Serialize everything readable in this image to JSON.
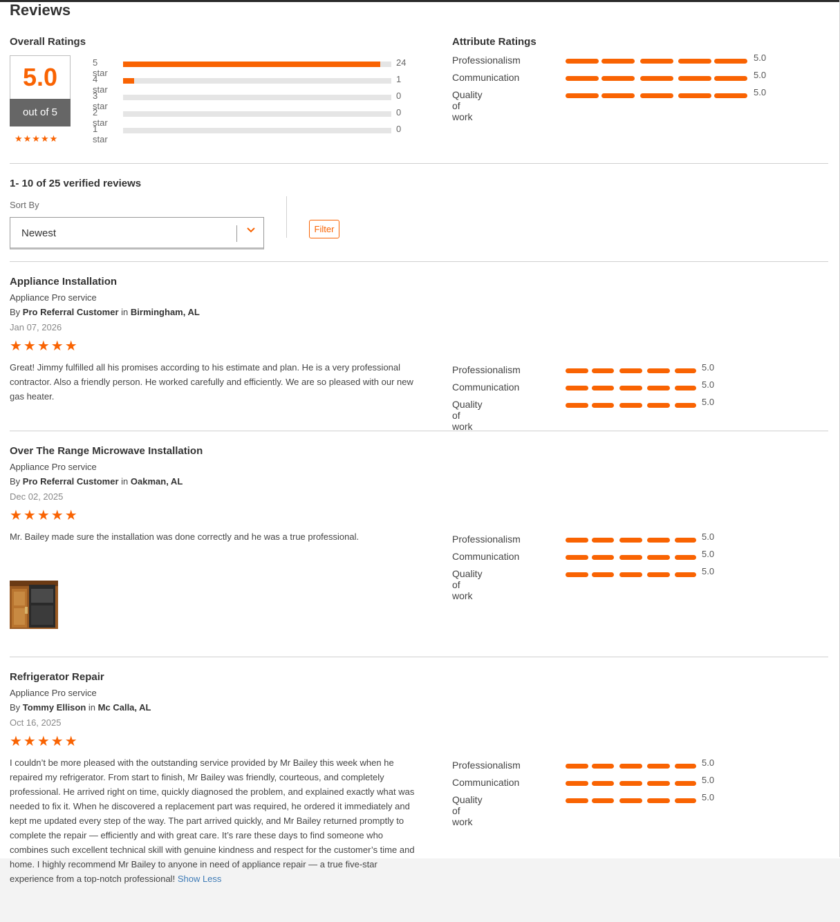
{
  "page": {
    "title": "Reviews"
  },
  "overall": {
    "heading": "Overall Ratings",
    "score": "5.0",
    "out_of": "out of 5",
    "stars": "★★★★★",
    "histogram": [
      {
        "label": "5 star",
        "count": "24",
        "fraction": 0.96
      },
      {
        "label": "4 star",
        "count": "1",
        "fraction": 0.04
      },
      {
        "label": "3 star",
        "count": "0",
        "fraction": 0
      },
      {
        "label": "2 star",
        "count": "0",
        "fraction": 0
      },
      {
        "label": "1 star",
        "count": "0",
        "fraction": 0
      }
    ]
  },
  "attributes": {
    "heading": "Attribute Ratings",
    "items": [
      {
        "label": "Professionalism",
        "value": "5.0"
      },
      {
        "label": "Communication",
        "value": "5.0"
      },
      {
        "label": "Quality of work",
        "value": "5.0"
      }
    ]
  },
  "list": {
    "count_text": "1- 10 of 25 verified reviews",
    "sort_label": "Sort By",
    "sort_value": "Newest",
    "filter_label": "Filter"
  },
  "reviews": [
    {
      "title": "Appliance Installation",
      "service": "Appliance Pro service",
      "by_prefix": "By",
      "author": "Pro Referral Customer",
      "in_word": "in",
      "location": "Birmingham, AL",
      "date": "Jan 07, 2026",
      "stars": "★★★★★",
      "text": "Great! Jimmy fulfilled all his promises according to his estimate and plan. He is a very professional contractor. Also a friendly person. He worked carefully and efficiently. We are so pleased with our new gas heater.",
      "ratings": [
        {
          "label": "Professionalism",
          "value": "5.0"
        },
        {
          "label": "Communication",
          "value": "5.0"
        },
        {
          "label": "Quality of work",
          "value": "5.0"
        }
      ]
    },
    {
      "title": "Over The Range Microwave Installation",
      "service": "Appliance Pro service",
      "by_prefix": "By",
      "author": "Pro Referral Customer",
      "in_word": "in",
      "location": "Oakman, AL",
      "date": "Dec 02, 2025",
      "stars": "★★★★★",
      "text": "Mr. Bailey made sure the installation was done correctly and he was a true professional.",
      "ratings": [
        {
          "label": "Professionalism",
          "value": "5.0"
        },
        {
          "label": "Communication",
          "value": "5.0"
        },
        {
          "label": "Quality of work",
          "value": "5.0"
        }
      ]
    },
    {
      "title": "Refrigerator Repair",
      "service": "Appliance Pro service",
      "by_prefix": "By",
      "author": "Tommy Ellison",
      "in_word": "in",
      "location": "Mc Calla, AL",
      "date": "Oct 16, 2025",
      "stars": "★★★★★",
      "text": "I couldn’t be more pleased with the outstanding service provided by Mr Bailey this week when he repaired my refrigerator. From start to finish, Mr Bailey was friendly, courteous, and completely professional. He arrived right on time, quickly diagnosed the problem, and explained exactly what was needed to fix it. When he discovered a replacement part was required, he ordered it immediately and kept me updated every step of the way. The part arrived quickly, and Mr Bailey returned promptly to complete the repair — efficiently and with great care. It’s rare these days to find someone who combines such excellent technical skill with genuine kindness and respect for the customer’s time and home. I highly recommend Mr Bailey to anyone in need of appliance repair — a true five-star experience from a top-notch professional!",
      "show_less": "Show Less",
      "ratings": [
        {
          "label": "Professionalism",
          "value": "5.0"
        },
        {
          "label": "Communication",
          "value": "5.0"
        },
        {
          "label": "Quality of work",
          "value": "5.0"
        }
      ]
    }
  ],
  "colors": {
    "accent": "#f96302",
    "link": "#3e7bb6",
    "score_band": "#666666"
  }
}
